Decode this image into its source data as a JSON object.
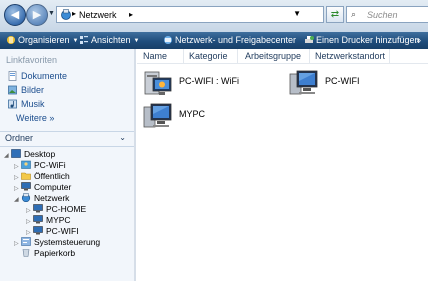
{
  "address": {
    "path": "Netzwerk",
    "search_placeholder": "Suchen"
  },
  "toolbar": {
    "organize": "Organisieren",
    "views": "Ansichten",
    "network_center": "Netzwerk- und Freigabecenter",
    "add_printer": "Einen Drucker hinzufügen",
    "more": "»"
  },
  "favorites": {
    "header": "Linkfavoriten",
    "items": [
      "Dokumente",
      "Bilder",
      "Musik"
    ],
    "more": "Weitere »"
  },
  "folders": {
    "header": "Ordner",
    "tree": [
      {
        "label": "Desktop"
      },
      {
        "label": "PC-WiFi"
      },
      {
        "label": "Öffentlich"
      },
      {
        "label": "Computer"
      },
      {
        "label": "Netzwerk"
      },
      {
        "label": "PC-HOME"
      },
      {
        "label": "MYPC"
      },
      {
        "label": "PC-WIFI"
      },
      {
        "label": "Systemsteuerung"
      },
      {
        "label": "Papierkorb"
      }
    ]
  },
  "columns": [
    "Name",
    "Kategorie",
    "Arbeitsgruppe",
    "Netzwerkstandort"
  ],
  "items": [
    {
      "label": "PC-WIFI : WiFi",
      "icon": "media-computer-icon"
    },
    {
      "label": "PC-WIFI",
      "icon": "computer-icon"
    },
    {
      "label": "MYPC",
      "icon": "computer-icon"
    }
  ],
  "colors": {
    "toolbar": "#1f4d7c",
    "pane": "#f2f6fb"
  }
}
